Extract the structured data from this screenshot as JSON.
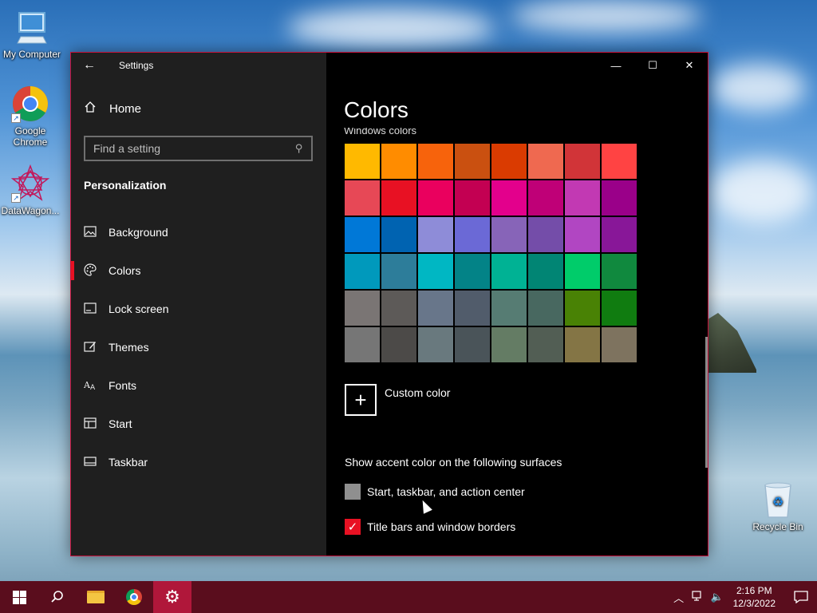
{
  "desktop": {
    "icons": [
      {
        "label": "My Computer",
        "icon": "monitor-icon"
      },
      {
        "label": "Google Chrome",
        "icon": "chrome-icon"
      },
      {
        "label": "DataWagon...",
        "icon": "datawagon-icon"
      },
      {
        "label": "Recycle Bin",
        "icon": "recycle-bin-icon"
      }
    ]
  },
  "window": {
    "app_title": "Settings",
    "back_icon": "←",
    "minimize_icon": "—",
    "maximize_icon": "☐",
    "close_icon": "✕",
    "accent_color": "#e81123",
    "border_color": "#c4123c"
  },
  "sidebar": {
    "home_label": "Home",
    "search_placeholder": "Find a setting",
    "section_title": "Personalization",
    "items": [
      {
        "label": "Background",
        "icon": "picture-icon",
        "glyph": "▭",
        "active": false
      },
      {
        "label": "Colors",
        "icon": "palette-icon",
        "glyph": "◔",
        "active": true
      },
      {
        "label": "Lock screen",
        "icon": "lock-screen-icon",
        "glyph": "▭",
        "active": false
      },
      {
        "label": "Themes",
        "icon": "themes-icon",
        "glyph": "✎",
        "active": false
      },
      {
        "label": "Fonts",
        "icon": "fonts-icon",
        "glyph": "A",
        "active": false
      },
      {
        "label": "Start",
        "icon": "start-icon",
        "glyph": "☷",
        "active": false
      },
      {
        "label": "Taskbar",
        "icon": "taskbar-icon",
        "glyph": "▭",
        "active": false
      }
    ]
  },
  "content": {
    "page_title": "Colors",
    "sub_heading": "Windows colors",
    "swatches": [
      "#FFB900",
      "#FF8C00",
      "#F7630C",
      "#CA5010",
      "#DA3B01",
      "#EF6950",
      "#D13438",
      "#FF4343",
      "#E74856",
      "#E81123",
      "#EA005E",
      "#C30052",
      "#E3008C",
      "#BF0077",
      "#C239B3",
      "#9A0089",
      "#0078D7",
      "#0063B1",
      "#8E8CD8",
      "#6B69D6",
      "#8764B8",
      "#744DA9",
      "#B146C2",
      "#881798",
      "#0099BC",
      "#2D7D9A",
      "#00B7C3",
      "#038387",
      "#00B294",
      "#018574",
      "#00CC6A",
      "#10893E",
      "#7A7574",
      "#5D5A58",
      "#68768A",
      "#515C6B",
      "#567C73",
      "#486860",
      "#498205",
      "#107C10",
      "#767676",
      "#4C4A48",
      "#69797E",
      "#4A5459",
      "#647C64",
      "#525E54",
      "#847545",
      "#7E735F"
    ],
    "custom_color_label": "Custom color",
    "accent_heading": "Show accent color on the following surfaces",
    "checkboxes": [
      {
        "label": "Start, taskbar, and action center",
        "checked": false
      },
      {
        "label": "Title bars and window borders",
        "checked": true
      }
    ]
  },
  "taskbar": {
    "clock_time": "2:16 PM",
    "clock_date": "12/3/2022",
    "color": "#5a0d1d"
  }
}
